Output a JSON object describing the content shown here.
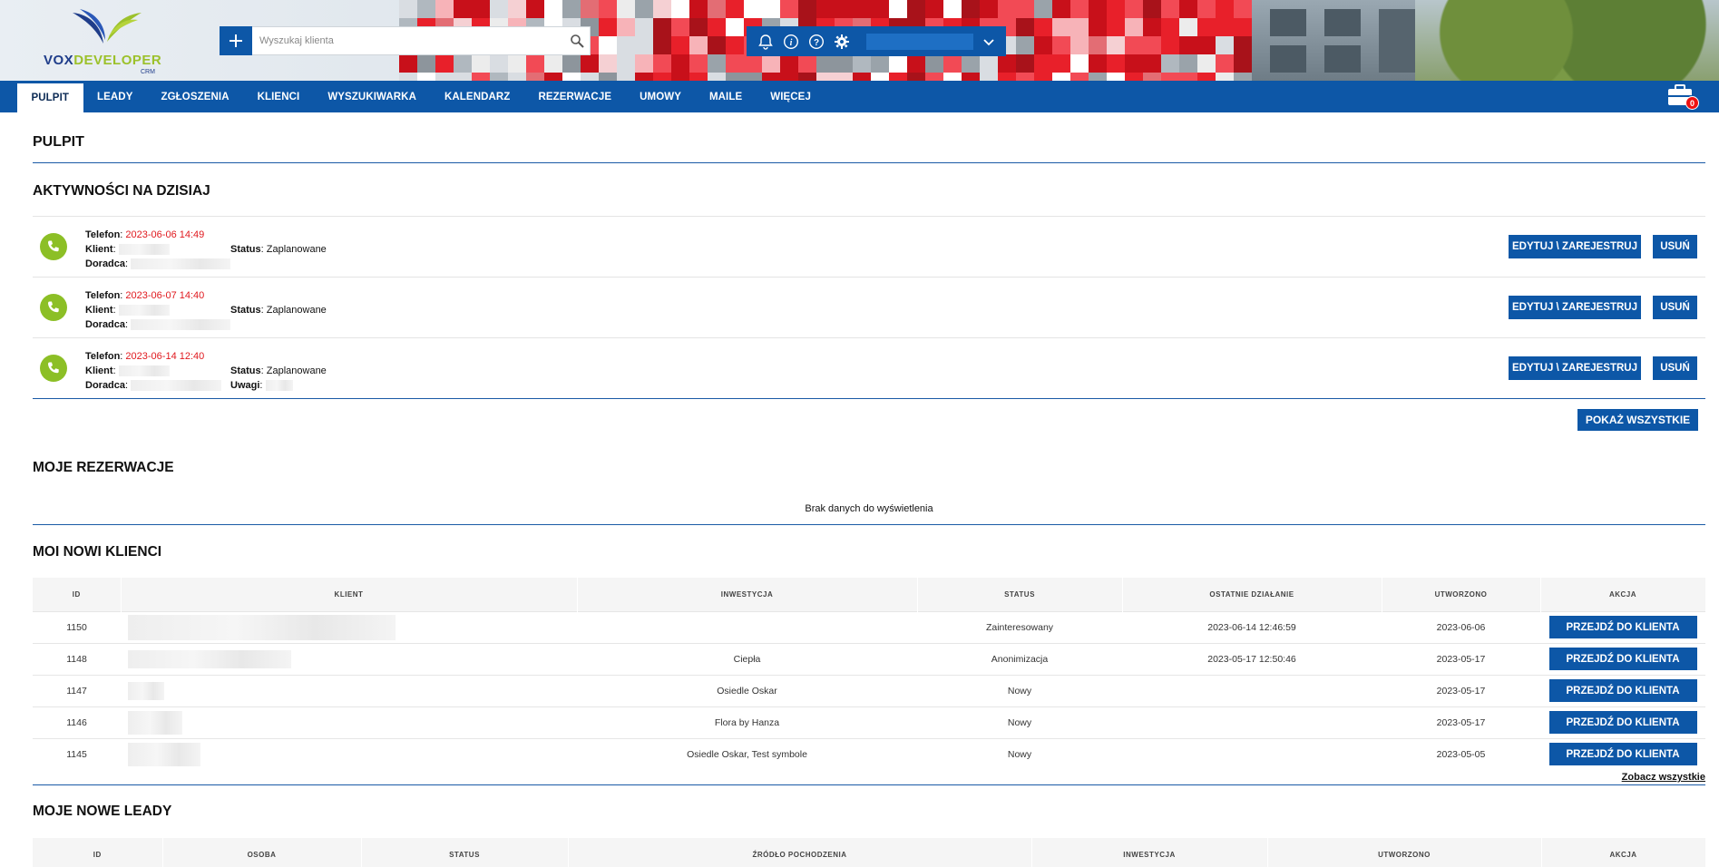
{
  "header": {
    "logo_text_part1": "VOX",
    "logo_text_part2": "DEVELOPER",
    "logo_sub": "CRM",
    "search_placeholder": "Wyszukaj klienta"
  },
  "nav": {
    "items": [
      "PULPIT",
      "LEADY",
      "ZGŁOSZENIA",
      "KLIENCI",
      "WYSZUKIWARKA",
      "KALENDARZ",
      "REZERWACJE",
      "UMOWY",
      "MAILE",
      "WIĘCEJ"
    ],
    "active": "PULPIT",
    "cart_count": "0"
  },
  "page": {
    "title": "PULPIT"
  },
  "activities": {
    "title": "AKTYWNOŚCI NA DZISIAJ",
    "labels": {
      "phone": "Telefon",
      "client": "Klient",
      "advisor": "Doradca",
      "status": "Status",
      "notes": "Uwagi"
    },
    "items": [
      {
        "datetime": "2023-06-06 14:49",
        "status": "Zaplanowane"
      },
      {
        "datetime": "2023-06-07 14:40",
        "status": "Zaplanowane"
      },
      {
        "datetime": "2023-06-14 12:40",
        "status": "Zaplanowane"
      }
    ],
    "edit_label": "EDYTUJ \\ ZAREJESTRUJ",
    "delete_label": "USUŃ",
    "show_all_label": "POKAŻ WSZYSTKIE"
  },
  "reservations": {
    "title": "MOJE REZERWACJE",
    "empty": "Brak danych do wyświetlenia"
  },
  "new_clients": {
    "title": "MOI NOWI KLIENCI",
    "columns": [
      "ID",
      "KLIENT",
      "INWESTYCJA",
      "STATUS",
      "OSTATNIE DZIAŁANIE",
      "UTWORZONO",
      "AKCJA"
    ],
    "rows": [
      {
        "id": "1150",
        "investment": "",
        "status": "Zainteresowany",
        "last_action": "2023-06-14 12:46:59",
        "created": "2023-06-06"
      },
      {
        "id": "1148",
        "investment": "Ciepła",
        "status": "Anonimizacja",
        "last_action": "2023-05-17 12:50:46",
        "created": "2023-05-17"
      },
      {
        "id": "1147",
        "investment": "Osiedle Oskar",
        "status": "Nowy",
        "last_action": "",
        "created": "2023-05-17"
      },
      {
        "id": "1146",
        "investment": "Flora by Hanza",
        "status": "Nowy",
        "last_action": "",
        "created": "2023-05-17"
      },
      {
        "id": "1145",
        "investment": "Osiedle Oskar, Test symbole",
        "status": "Nowy",
        "last_action": "",
        "created": "2023-05-05"
      }
    ],
    "go_label": "PRZEJDŹ DO KLIENTA",
    "see_all": "Zobacz wszystkie"
  },
  "new_leads": {
    "title": "MOJE NOWE LEADY",
    "columns": [
      "ID",
      "OSOBA",
      "STATUS",
      "ŹRÓDŁO POCHODZENIA",
      "INWESTYCJA",
      "UTWORZONO",
      "AKCJA"
    ]
  },
  "colors": {
    "brand_blue": "#0d57a7",
    "accent_green": "#8cbf26",
    "date_red": "#e0191e"
  }
}
